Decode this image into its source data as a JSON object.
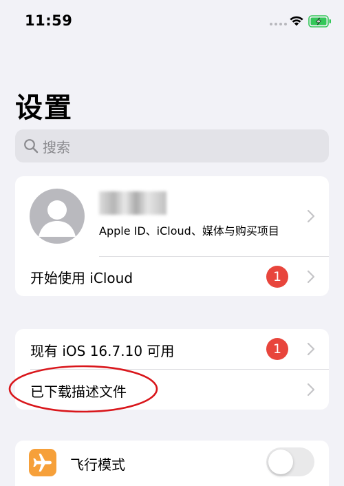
{
  "status_bar": {
    "time": "11:59"
  },
  "page": {
    "title": "设置"
  },
  "search": {
    "placeholder": "搜索"
  },
  "account": {
    "subtitle": "Apple ID、iCloud、媒体与购买项目",
    "icloud_row": {
      "label": "开始使用 iCloud",
      "badge": "1"
    }
  },
  "updates": {
    "ios_update": {
      "label": "现有 iOS 16.7.10 可用",
      "badge": "1"
    },
    "profiles": {
      "label": "已下载描述文件"
    }
  },
  "settings": {
    "airplane_mode": {
      "label": "飞行模式",
      "enabled": false,
      "icon": "airplane-icon"
    }
  },
  "colors": {
    "accent_orange": "#f6a03a",
    "badge_red": "#e8453c",
    "background": "#f2f2f7",
    "annotation": "#d9161b"
  }
}
